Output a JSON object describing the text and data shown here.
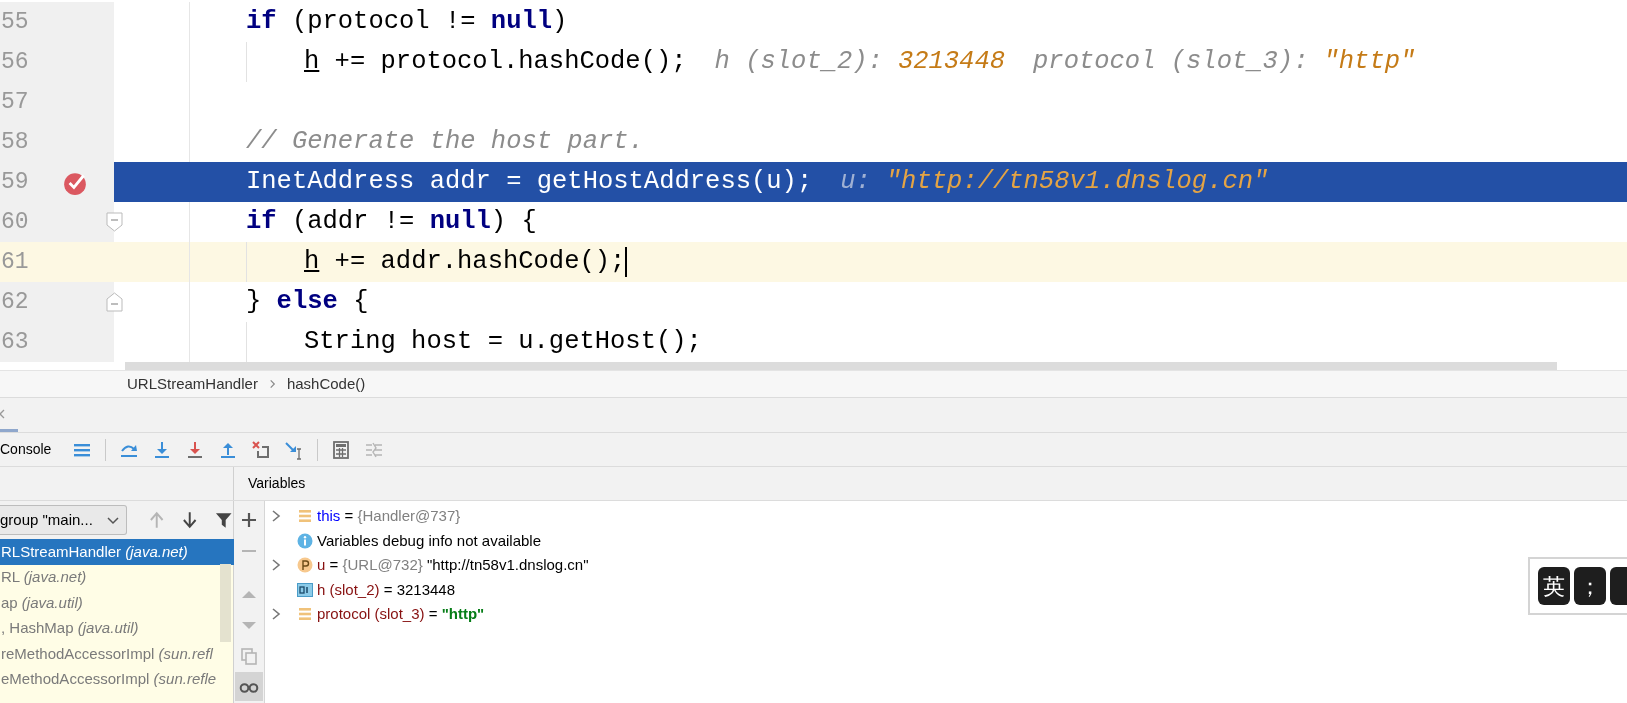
{
  "editor": {
    "lines": [
      {
        "number": "55",
        "selected": false,
        "current": false,
        "breakpoint": false,
        "segments": [
          {
            "kind": "keyword",
            "text": "if"
          },
          {
            "kind": "plain",
            "text": " (protocol != "
          },
          {
            "kind": "keyword",
            "text": "null"
          },
          {
            "kind": "plain",
            "text": ")"
          }
        ],
        "children": [
          {
            "number": "56",
            "selected": false,
            "current": false,
            "breakpoint": false,
            "segments": [
              {
                "kind": "reassigned",
                "text": "h"
              },
              {
                "kind": "plain",
                "text": " += protocol.hashCode();"
              }
            ],
            "hints": [
              {
                "label": "h (slot_2):",
                "value": "3213448"
              },
              {
                "label": "protocol (slot_3):",
                "value": "\"http\""
              }
            ]
          }
        ]
      },
      {
        "number": "57",
        "selected": false,
        "current": false,
        "breakpoint": false
      },
      {
        "number": "58",
        "selected": false,
        "current": false,
        "breakpoint": false,
        "segments": [
          {
            "kind": "comment",
            "text": "// Generate the host part."
          }
        ]
      },
      {
        "number": "59",
        "selected": true,
        "current": false,
        "breakpoint": true,
        "segments": [
          {
            "kind": "plain",
            "text": "InetAddress addr = getHostAddress(u);"
          }
        ],
        "hints": [
          {
            "label": "u:",
            "value": "\"http://tn58v1.dnslog.cn\""
          }
        ]
      },
      {
        "number": "60",
        "selected": false,
        "current": false,
        "breakpoint": false,
        "fold": {
          "kind": "start"
        },
        "segments": [
          {
            "kind": "keyword",
            "text": "if"
          },
          {
            "kind": "plain",
            "text": " (addr != "
          },
          {
            "kind": "keyword",
            "text": "null"
          },
          {
            "kind": "plain",
            "text": ") {"
          }
        ],
        "children": [
          {
            "number": "61",
            "selected": false,
            "current": true,
            "breakpoint": false,
            "segments": [
              {
                "kind": "reassigned",
                "text": "h"
              },
              {
                "kind": "plain",
                "text": " += addr.hashCode();"
              }
            ]
          }
        ]
      },
      {
        "number": "62",
        "selected": false,
        "current": false,
        "breakpoint": false,
        "fold": {
          "kind": "end"
        },
        "segments": [
          {
            "kind": "plain",
            "text": "} "
          },
          {
            "kind": "keyword",
            "text": "else"
          },
          {
            "kind": "plain",
            "text": " {"
          }
        ],
        "children": [
          {
            "number": "63",
            "selected": false,
            "current": false,
            "breakpoint": false,
            "segments": [
              {
                "kind": "plain",
                "text": "String host = u.getHost();"
              }
            ]
          }
        ]
      }
    ]
  },
  "breadcrumb": [
    "URLStreamHandler",
    "hashCode()"
  ],
  "session_tab": {
    "selected": true
  },
  "toolbar": {
    "label": "Console",
    "buttons": [
      {
        "kind": "layout",
        "disabled": false
      },
      {
        "kind": "separator"
      },
      {
        "kind": "step_over",
        "disabled": false
      },
      {
        "kind": "step_into",
        "disabled": false
      },
      {
        "kind": "force_step_into",
        "disabled": false
      },
      {
        "kind": "step_out",
        "disabled": false
      },
      {
        "kind": "drop_frame",
        "disabled": false
      },
      {
        "kind": "run_to_cursor",
        "disabled": false
      },
      {
        "kind": "separator"
      },
      {
        "kind": "evaluate",
        "disabled": false
      },
      {
        "kind": "trace",
        "disabled": true
      }
    ]
  },
  "frames_panel": {
    "thread": "group \"main...",
    "buttons": [
      {
        "kind": "up",
        "disabled": true
      },
      {
        "kind": "down",
        "disabled": false
      },
      {
        "kind": "filter",
        "disabled": false
      }
    ],
    "frames": [
      {
        "text": "RLStreamHandler *(java.net)*",
        "selected": true
      },
      {
        "text": "RL *(java.net)*",
        "selected": false
      },
      {
        "text": "ap *(java.util)*",
        "selected": false
      },
      {
        "text": ", HashMap *(java.util)*",
        "selected": false
      },
      {
        "text": "reMethodAccessorImpl *(sun.refl*",
        "selected": false
      },
      {
        "text": "eMethodAccessorImpl *(sun.refle*",
        "selected": false
      }
    ]
  },
  "variables_panel": {
    "title": "Variables",
    "tools": [
      {
        "kind": "add",
        "disabled": false,
        "on": false
      },
      {
        "kind": "remove",
        "disabled": true,
        "on": false
      },
      {
        "kind": "up",
        "disabled": true,
        "on": false
      },
      {
        "kind": "down",
        "disabled": true,
        "on": false
      },
      {
        "kind": "copy",
        "disabled": true,
        "on": false
      },
      {
        "kind": "watches",
        "disabled": false,
        "on": true
      }
    ],
    "variables": [
      {
        "kind": "object",
        "expandable": true,
        "name": "this",
        "self": true,
        "separator": "=",
        "type": "{Handler@737}"
      },
      {
        "kind": "message",
        "expandable": false,
        "text": "Variables debug info not available"
      },
      {
        "kind": "parameter",
        "expandable": true,
        "name": "u",
        "self": false,
        "separator": "=",
        "type": "{URL@732}",
        "value": "\"http://tn58v1.dnslog.cn\"",
        "string_literal": false
      },
      {
        "kind": "primitive",
        "expandable": false,
        "name": "h (slot_2)",
        "self": false,
        "separator": "=",
        "value": "3213448",
        "string_literal": false
      },
      {
        "kind": "object",
        "expandable": true,
        "name": "protocol (slot_3)",
        "self": false,
        "separator": "=",
        "value": "\"http\"",
        "string_literal": true
      }
    ]
  },
  "ime_bar": {
    "keys": [
      "英",
      "；"
    ]
  }
}
